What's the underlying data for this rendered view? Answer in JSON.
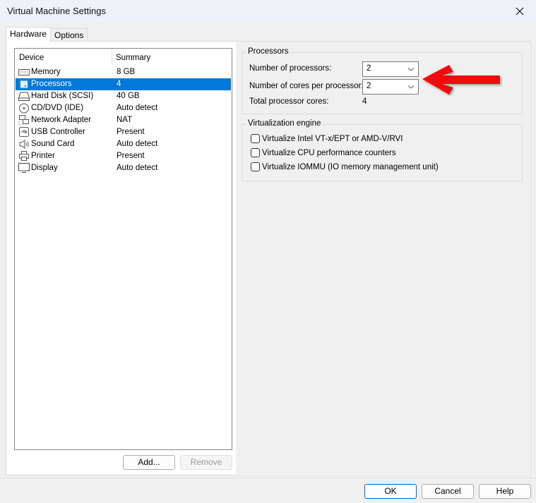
{
  "window": {
    "title": "Virtual Machine Settings"
  },
  "tabs": [
    {
      "label": "Hardware",
      "active": true
    },
    {
      "label": "Options",
      "active": false
    }
  ],
  "device_list": {
    "columns": [
      "Device",
      "Summary"
    ],
    "rows": [
      {
        "icon": "memory-icon",
        "device": "Memory",
        "summary": "8 GB",
        "selected": false
      },
      {
        "icon": "processor-icon",
        "device": "Processors",
        "summary": "4",
        "selected": true
      },
      {
        "icon": "hard-disk-icon",
        "device": "Hard Disk (SCSI)",
        "summary": "40 GB",
        "selected": false
      },
      {
        "icon": "cd-dvd-icon",
        "device": "CD/DVD (IDE)",
        "summary": "Auto detect",
        "selected": false
      },
      {
        "icon": "network-adapter-icon",
        "device": "Network Adapter",
        "summary": "NAT",
        "selected": false
      },
      {
        "icon": "usb-icon",
        "device": "USB Controller",
        "summary": "Present",
        "selected": false
      },
      {
        "icon": "sound-card-icon",
        "device": "Sound Card",
        "summary": "Auto detect",
        "selected": false
      },
      {
        "icon": "printer-icon",
        "device": "Printer",
        "summary": "Present",
        "selected": false
      },
      {
        "icon": "display-icon",
        "device": "Display",
        "summary": "Auto detect",
        "selected": false
      }
    ],
    "add_label": "Add...",
    "remove_label": "Remove"
  },
  "processors": {
    "group_label": "Processors",
    "num_processors_label": "Number of processors:",
    "num_processors_value": "2",
    "cores_per_processor_label": "Number of cores per processor:",
    "cores_per_processor_value": "2",
    "total_cores_label": "Total processor cores:",
    "total_cores_value": "4"
  },
  "virtualization": {
    "group_label": "Virtualization engine",
    "options": [
      {
        "label": "Virtualize Intel VT-x/EPT or AMD-V/RVI",
        "checked": false
      },
      {
        "label": "Virtualize CPU performance counters",
        "checked": false
      },
      {
        "label": "Virtualize IOMMU (IO memory management unit)",
        "checked": false
      }
    ]
  },
  "annotation": {
    "arrow_color": "#ee1111"
  },
  "footer": {
    "ok_label": "OK",
    "cancel_label": "Cancel",
    "help_label": "Help"
  },
  "colors": {
    "selection": "#0078d7",
    "default_button_border": "#0067c0"
  }
}
